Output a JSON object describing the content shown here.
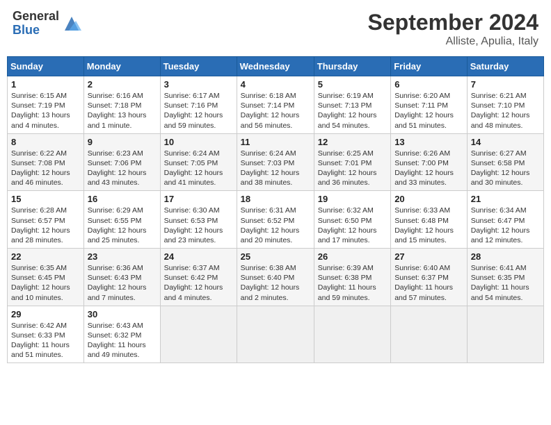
{
  "header": {
    "logo_general": "General",
    "logo_blue": "Blue",
    "title": "September 2024",
    "location": "Alliste, Apulia, Italy"
  },
  "days_of_week": [
    "Sunday",
    "Monday",
    "Tuesday",
    "Wednesday",
    "Thursday",
    "Friday",
    "Saturday"
  ],
  "weeks": [
    [
      {
        "day": "1",
        "info": "Sunrise: 6:15 AM\nSunset: 7:19 PM\nDaylight: 13 hours\nand 4 minutes."
      },
      {
        "day": "2",
        "info": "Sunrise: 6:16 AM\nSunset: 7:18 PM\nDaylight: 13 hours\nand 1 minute."
      },
      {
        "day": "3",
        "info": "Sunrise: 6:17 AM\nSunset: 7:16 PM\nDaylight: 12 hours\nand 59 minutes."
      },
      {
        "day": "4",
        "info": "Sunrise: 6:18 AM\nSunset: 7:14 PM\nDaylight: 12 hours\nand 56 minutes."
      },
      {
        "day": "5",
        "info": "Sunrise: 6:19 AM\nSunset: 7:13 PM\nDaylight: 12 hours\nand 54 minutes."
      },
      {
        "day": "6",
        "info": "Sunrise: 6:20 AM\nSunset: 7:11 PM\nDaylight: 12 hours\nand 51 minutes."
      },
      {
        "day": "7",
        "info": "Sunrise: 6:21 AM\nSunset: 7:10 PM\nDaylight: 12 hours\nand 48 minutes."
      }
    ],
    [
      {
        "day": "8",
        "info": "Sunrise: 6:22 AM\nSunset: 7:08 PM\nDaylight: 12 hours\nand 46 minutes."
      },
      {
        "day": "9",
        "info": "Sunrise: 6:23 AM\nSunset: 7:06 PM\nDaylight: 12 hours\nand 43 minutes."
      },
      {
        "day": "10",
        "info": "Sunrise: 6:24 AM\nSunset: 7:05 PM\nDaylight: 12 hours\nand 41 minutes."
      },
      {
        "day": "11",
        "info": "Sunrise: 6:24 AM\nSunset: 7:03 PM\nDaylight: 12 hours\nand 38 minutes."
      },
      {
        "day": "12",
        "info": "Sunrise: 6:25 AM\nSunset: 7:01 PM\nDaylight: 12 hours\nand 36 minutes."
      },
      {
        "day": "13",
        "info": "Sunrise: 6:26 AM\nSunset: 7:00 PM\nDaylight: 12 hours\nand 33 minutes."
      },
      {
        "day": "14",
        "info": "Sunrise: 6:27 AM\nSunset: 6:58 PM\nDaylight: 12 hours\nand 30 minutes."
      }
    ],
    [
      {
        "day": "15",
        "info": "Sunrise: 6:28 AM\nSunset: 6:57 PM\nDaylight: 12 hours\nand 28 minutes."
      },
      {
        "day": "16",
        "info": "Sunrise: 6:29 AM\nSunset: 6:55 PM\nDaylight: 12 hours\nand 25 minutes."
      },
      {
        "day": "17",
        "info": "Sunrise: 6:30 AM\nSunset: 6:53 PM\nDaylight: 12 hours\nand 23 minutes."
      },
      {
        "day": "18",
        "info": "Sunrise: 6:31 AM\nSunset: 6:52 PM\nDaylight: 12 hours\nand 20 minutes."
      },
      {
        "day": "19",
        "info": "Sunrise: 6:32 AM\nSunset: 6:50 PM\nDaylight: 12 hours\nand 17 minutes."
      },
      {
        "day": "20",
        "info": "Sunrise: 6:33 AM\nSunset: 6:48 PM\nDaylight: 12 hours\nand 15 minutes."
      },
      {
        "day": "21",
        "info": "Sunrise: 6:34 AM\nSunset: 6:47 PM\nDaylight: 12 hours\nand 12 minutes."
      }
    ],
    [
      {
        "day": "22",
        "info": "Sunrise: 6:35 AM\nSunset: 6:45 PM\nDaylight: 12 hours\nand 10 minutes."
      },
      {
        "day": "23",
        "info": "Sunrise: 6:36 AM\nSunset: 6:43 PM\nDaylight: 12 hours\nand 7 minutes."
      },
      {
        "day": "24",
        "info": "Sunrise: 6:37 AM\nSunset: 6:42 PM\nDaylight: 12 hours\nand 4 minutes."
      },
      {
        "day": "25",
        "info": "Sunrise: 6:38 AM\nSunset: 6:40 PM\nDaylight: 12 hours\nand 2 minutes."
      },
      {
        "day": "26",
        "info": "Sunrise: 6:39 AM\nSunset: 6:38 PM\nDaylight: 11 hours\nand 59 minutes."
      },
      {
        "day": "27",
        "info": "Sunrise: 6:40 AM\nSunset: 6:37 PM\nDaylight: 11 hours\nand 57 minutes."
      },
      {
        "day": "28",
        "info": "Sunrise: 6:41 AM\nSunset: 6:35 PM\nDaylight: 11 hours\nand 54 minutes."
      }
    ],
    [
      {
        "day": "29",
        "info": "Sunrise: 6:42 AM\nSunset: 6:33 PM\nDaylight: 11 hours\nand 51 minutes."
      },
      {
        "day": "30",
        "info": "Sunrise: 6:43 AM\nSunset: 6:32 PM\nDaylight: 11 hours\nand 49 minutes."
      },
      {
        "day": "",
        "info": ""
      },
      {
        "day": "",
        "info": ""
      },
      {
        "day": "",
        "info": ""
      },
      {
        "day": "",
        "info": ""
      },
      {
        "day": "",
        "info": ""
      }
    ]
  ]
}
